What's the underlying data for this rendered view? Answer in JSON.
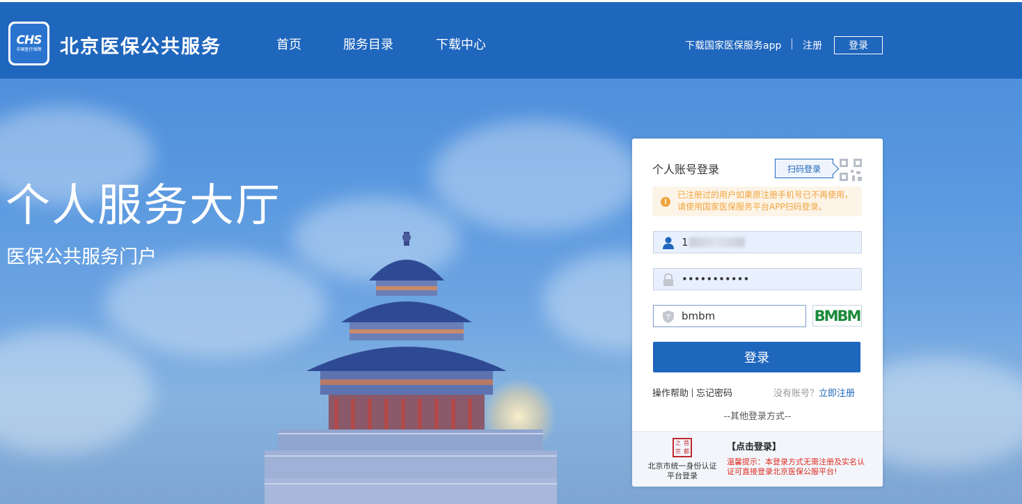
{
  "header": {
    "logo_text": "CHS",
    "logo_sub": "中国医疗保障",
    "site_title": "北京医保公共服务",
    "nav": [
      "首页",
      "服务目录",
      "下载中心"
    ],
    "download_app": "下载国家医保服务app",
    "register": "注册",
    "login": "登录"
  },
  "hero": {
    "title": "个人服务大厅",
    "subtitle": "医保公共服务门户"
  },
  "login_panel": {
    "title": "个人账号登录",
    "qr_login": "扫码登录",
    "notice": "已注册过的用户如果原注册手机号已不再使用，请使用国家医保服务平台APP扫码登录。",
    "username_value": "1",
    "password_value": "•••••••••••",
    "captcha_value": "bmbm",
    "captcha_image_text": "BMBM",
    "submit": "登录",
    "help": "操作帮助",
    "forgot": "忘记密码",
    "no_account": "没有账号？",
    "register_now": "立即注册",
    "other_methods": "--其他登录方式--",
    "seal_chars": [
      "之",
      "首",
      "京",
      "都"
    ],
    "unified_login": "北京市统一身份认证平台登录",
    "click_login": "【点击登录】",
    "tip": "温馨提示：本登录方式无需注册及实名认证可直接登录北京医保公服平台!"
  },
  "colors": {
    "primary": "#1f66bd",
    "notice": "#f0a43c",
    "warning_red": "#e02b20"
  }
}
